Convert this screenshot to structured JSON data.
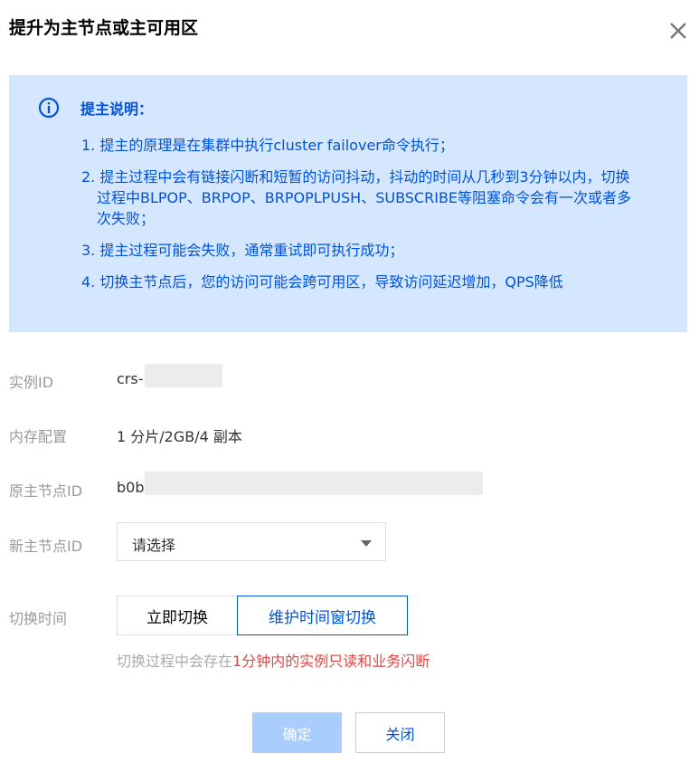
{
  "dialog": {
    "title": "提升为主节点或主可用区",
    "close_icon": "close-icon"
  },
  "notice": {
    "icon": "info-icon",
    "title": "提主说明：",
    "items": [
      "1. 提主的原理是在集群中执行cluster failover命令执行；",
      "2. 提主过程中会有链接闪断和短暂的访问抖动，抖动的时间从几秒到3分钟以内，切换过程中BLPOP、BRPOP、BRPOPLPUSH、SUBSCRIBE等阻塞命令会有一次或者多次失败；",
      "3. 提主过程可能会失败，通常重试即可执行成功；",
      "4. 切换主节点后，您的访问可能会跨可用区，导致访问延迟增加，QPS降低"
    ]
  },
  "form": {
    "instance_id": {
      "label": "实例ID",
      "value": "crs-"
    },
    "memory_config": {
      "label": "内存配置",
      "value": "1 分片/2GB/4 副本"
    },
    "old_master_id": {
      "label": "原主节点ID",
      "value": "b0b"
    },
    "new_master_id": {
      "label": "新主节点ID",
      "placeholder": "请选择"
    },
    "switch_time": {
      "label": "切换时间",
      "options": [
        "立即切换",
        "维护时间窗切换"
      ],
      "selected": "维护时间窗切换"
    },
    "hint_prefix": "切换过程中会存在",
    "hint_warning": "1分钟内的实例只读和业务闪断"
  },
  "footer": {
    "confirm_label": "确定",
    "close_label": "关闭"
  },
  "colors": {
    "primary": "#0052d9",
    "notice_bg": "#d5e7ff",
    "warning": "#e54545",
    "confirm_disabled": "#a9cdfd"
  }
}
